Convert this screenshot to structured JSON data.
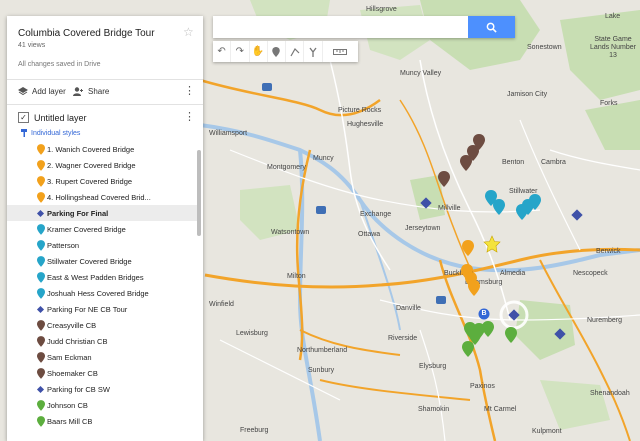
{
  "app": {
    "title": "Columbia Covered Bridge Tour",
    "views": "41 views",
    "saved_status": "All changes saved in Drive",
    "add_layer": "Add layer",
    "share": "Share"
  },
  "layer": {
    "name": "Untitled layer",
    "checked": true,
    "style_link": "Individual styles",
    "items": [
      {
        "label": "1. Wanich Covered Bridge",
        "icon": "pin",
        "color": "#f2a11c"
      },
      {
        "label": "2. Wagner Covered Bridge",
        "icon": "pin",
        "color": "#f2a11c"
      },
      {
        "label": "3. Rupert Covered Bridge",
        "icon": "pin",
        "color": "#f2a11c"
      },
      {
        "label": "4. Hollingshead Covered Brid...",
        "icon": "pin",
        "color": "#f2a11c"
      },
      {
        "label": "Parking For Final",
        "icon": "diamond",
        "color": "#3f51a8",
        "selected": true
      },
      {
        "label": "Kramer Covered Bridge",
        "icon": "pin",
        "color": "#26a5c9"
      },
      {
        "label": "Patterson",
        "icon": "pin",
        "color": "#26a5c9"
      },
      {
        "label": "Stillwater Covered Bridge",
        "icon": "pin",
        "color": "#26a5c9"
      },
      {
        "label": "East & West Padden Bridges",
        "icon": "pin",
        "color": "#26a5c9"
      },
      {
        "label": "Joshuah Hess Covered Bridge",
        "icon": "pin",
        "color": "#26a5c9"
      },
      {
        "label": "Parking For NE CB Tour",
        "icon": "diamond",
        "color": "#3f51a8"
      },
      {
        "label": "Creasyville CB",
        "icon": "pin",
        "color": "#6d4c41"
      },
      {
        "label": "Judd Christian CB",
        "icon": "pin",
        "color": "#6d4c41"
      },
      {
        "label": "Sam Eckman",
        "icon": "pin",
        "color": "#6d4c41"
      },
      {
        "label": "Shoemaker CB",
        "icon": "pin",
        "color": "#6d4c41"
      },
      {
        "label": "Parking for CB SW",
        "icon": "diamond",
        "color": "#3f51a8"
      },
      {
        "label": "Johnson CB",
        "icon": "pin",
        "color": "#5cae3e"
      },
      {
        "label": "Baars Mill CB",
        "icon": "pin",
        "color": "#5cae3e"
      }
    ]
  },
  "toolbar": {
    "search_placeholder": "",
    "tools": [
      "undo-icon",
      "redo-icon",
      "hand-icon",
      "marker-icon",
      "line-icon",
      "directions-icon",
      "ruler-icon"
    ]
  },
  "map": {
    "labels": [
      "Hillsgrove",
      "Muncy Valley",
      "Picture Rocks",
      "Hughesville",
      "Williamsport",
      "Muncy",
      "Montgomery",
      "Watsontown",
      "Exchange",
      "Ottawa",
      "Jerseytown",
      "Millville",
      "Benton",
      "Cambra",
      "Stillwater",
      "Jamison City",
      "State Game Lands Number 13",
      "Sonestown",
      "Berwick",
      "Almedia",
      "Bloomsburg",
      "Buckhorn",
      "Danville",
      "Milton",
      "Lewisburg",
      "Northumberland",
      "Sunbury",
      "Riverside",
      "Elysburg",
      "Shamokin",
      "Mt Carmel",
      "Nuremberg",
      "Shenandoah",
      "Freeburg",
      "Winfield",
      "Paxinos",
      "Kulpmont",
      "Nescopeck",
      "Lake",
      "Forks"
    ],
    "highlight_marker": "B"
  }
}
